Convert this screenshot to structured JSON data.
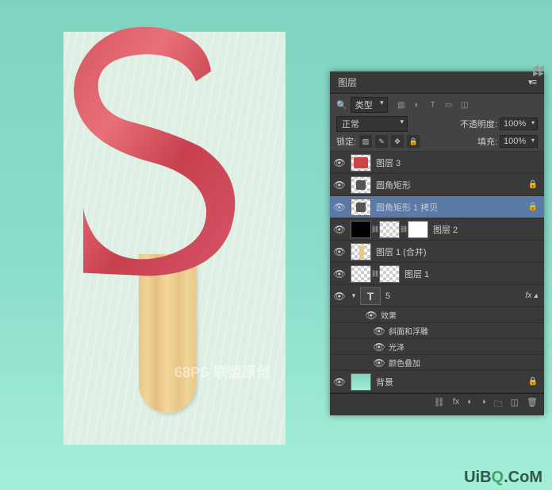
{
  "canvas": {
    "watermark_center": "68PS 联盟原创",
    "watermark_br_prefix": "UiB",
    "watermark_br_q": "Q",
    "watermark_br_suffix": ".CoM"
  },
  "panel": {
    "title": "图层",
    "filter": {
      "label": "类型"
    },
    "blend_mode": "正常",
    "opacity": {
      "label": "不透明度:",
      "value": "100%"
    },
    "lock": {
      "label": "锁定:"
    },
    "fill": {
      "label": "填充:",
      "value": "100%"
    },
    "layers": [
      {
        "name": "图层 3",
        "locked": false
      },
      {
        "name": "圆角矩形",
        "locked": true
      },
      {
        "name": "圆角矩形 1 拷贝",
        "locked": true,
        "selected": true
      },
      {
        "name": "图层 2",
        "locked": false
      },
      {
        "name": "图层 1 (合并)",
        "locked": false
      },
      {
        "name": "图层 1",
        "locked": false
      },
      {
        "name": "5",
        "is_text": true,
        "fx": true
      },
      {
        "name": "背景",
        "locked": true,
        "is_bg": true
      }
    ],
    "effects": {
      "header": "效果",
      "items": [
        "斜面和浮雕",
        "光泽",
        "颜色叠加"
      ]
    }
  }
}
